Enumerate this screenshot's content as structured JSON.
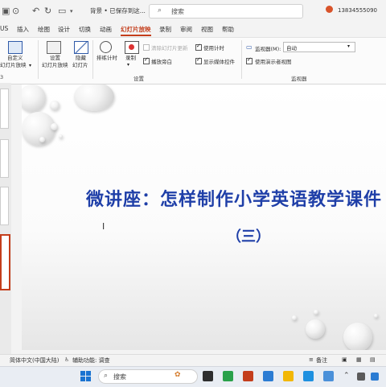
{
  "window": {
    "doc_title": "背景 • 已保存到这...",
    "search_placeholder": "搜索",
    "user_text": "13834555090"
  },
  "menu": {
    "items": [
      "US",
      "插入",
      "绘图",
      "设计",
      "切换",
      "动画",
      "幻灯片放映",
      "录制",
      "审阅",
      "视图",
      "帮助"
    ],
    "active": "幻灯片放映"
  },
  "ribbon": {
    "custom_show_label_1": "自定义",
    "custom_show_label_2": "幻灯片放映",
    "setup_show_label_1": "设置",
    "setup_show_label_2": "幻灯片放映",
    "hide_slide_label_1": "隐藏",
    "hide_slide_label_2": "幻灯片",
    "rehearse_label": "排练计时",
    "record_label": "录制",
    "play_narrations": "播放旁白",
    "use_timings": "使用计时",
    "show_media_controls": "显示媒体控件",
    "clear_timing": "清除幻灯片更新",
    "setup_group_label": "设置",
    "monitor_label": "监视器(M):",
    "monitor_value": "自动",
    "presenter_view": "使用演示者视图",
    "monitors_group_label": "监视器",
    "left_group_fragment": "3"
  },
  "slide": {
    "title": "微讲座：怎样制作小学英语教学课件",
    "subtitle": "（三）"
  },
  "statusbar": {
    "language": "简体中文(中国大陆)",
    "accessibility": "辅助功能: 调查",
    "notes": "备注"
  },
  "taskbar": {
    "search_placeholder": "搜索"
  },
  "colors": {
    "accent": "#c43e1c",
    "slide_text": "#1f3fa8"
  }
}
